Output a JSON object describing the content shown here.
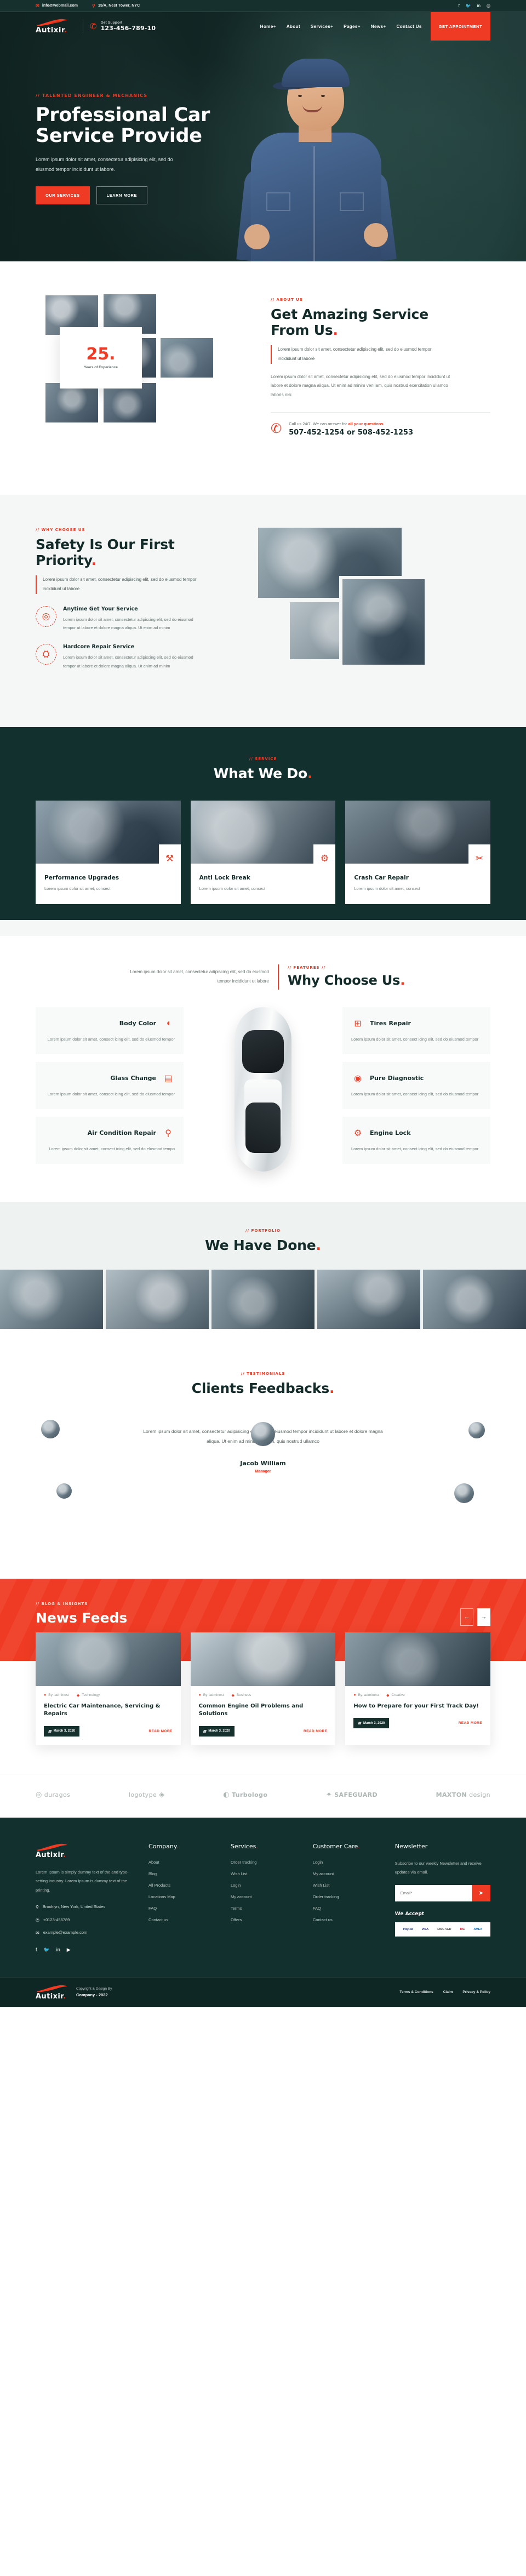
{
  "topbar": {
    "email": "info@webmail.com",
    "address": "15/A, Nest Tower, NYC",
    "socials": [
      "facebook-icon",
      "twitter-icon",
      "linkedin-icon",
      "instagram-icon"
    ]
  },
  "header": {
    "brand": "Autixir",
    "brand_dot": ".",
    "support_label": "Get Support",
    "support_phone": "123-456-789-10",
    "nav": [
      {
        "label": "Home",
        "caret": "+"
      },
      {
        "label": "About",
        "caret": ""
      },
      {
        "label": "Services",
        "caret": "+"
      },
      {
        "label": "Pages",
        "caret": "+"
      },
      {
        "label": "News",
        "caret": "+"
      },
      {
        "label": "Contact Us",
        "caret": ""
      }
    ],
    "cta": "GET APPOINTMENT"
  },
  "hero": {
    "eyebrow": "// TALENTED ENGINEER & MECHANICS",
    "title_line1": "Professional Car",
    "title_line2": "Service Provide",
    "subtitle": "Lorem ipsum dolor sit amet, consectetur adipisicing elit, sed do eiusmod tempor incididunt ut labore.",
    "btn_primary": "OUR SERVICES",
    "btn_secondary": "LEARN MORE"
  },
  "about": {
    "eyebrow": "// ABOUT US",
    "title_line1": "Get Amazing Service",
    "title_line2": "From Us",
    "lead": "Lorem ipsum dolor sit amet, consectetur adipiscing elit, sed do eiusmod tempor incididunt ut labore",
    "body": "Lorem ipsum dolor sit amet, consectetur adipisicing elit, sed do eiusmod tempor incididunt ut labore et dolore magna aliqua. Ut enim ad minim ven iam, quis nostrud exercitation ullamco laboris nisi",
    "experience_number": "25.",
    "experience_label": "Years of Experience",
    "call_prefix": "Call us 24/7. We can answer for ",
    "call_highlight": "all your questions",
    "call_suffix": ".",
    "phones": "507-452-1254 or 508-452-1253"
  },
  "safety": {
    "eyebrow": "// WHY CHOOSE US",
    "title_line1": "Safety Is Our First",
    "title_line2": "Priority",
    "lead": "Lorem ipsum dolor sit amet, consectetur adipiscing elit, sed do eiusmod tempor incididunt ut labore",
    "features": [
      {
        "icon": "wheel-icon",
        "glyph": "◎",
        "title": "Anytime Get Your Service",
        "text": "Lorem ipsum dolor sit amet, consectetur adipiscing elit, sed do eiusmod tempor ut labore et dolore magna aliqua. Ut enim ad minim"
      },
      {
        "icon": "car-wrench-icon",
        "glyph": "⛭",
        "title": "Hardcore Repair Service",
        "text": "Lorem ipsum dolor sit amet, consectetur adipiscing elit, sed do eiusmod tempor ut labore et dolore magna aliqua. Ut enim ad minim"
      }
    ]
  },
  "service": {
    "eyebrow": "// SERVICE",
    "title": "What We Do",
    "cards": [
      {
        "title": "Performance Upgrades",
        "text": "Lorem ipsum dolor sit amet, consect",
        "icon": "mechanic-tools-icon",
        "glyph": "⚒"
      },
      {
        "title": "Anti Lock Break",
        "text": "Lorem ipsum dolor sit amet, consect",
        "icon": "engine-gear-icon",
        "glyph": "⚙"
      },
      {
        "title": "Crash Car Repair",
        "text": "Lorem ipsum dolor sit amet, consect",
        "icon": "crossed-tools-icon",
        "glyph": "✂"
      }
    ]
  },
  "why": {
    "left_text": "Lorem ipsum dolor sit amet, consectetur adipiscing elit, sed do eiusmod tempor incididunt ut labore",
    "eyebrow": "// FEATURES //",
    "title": "Why Choose Us",
    "left_cards": [
      {
        "title": "Body Color",
        "text": "Lorem ipsum dolor sit amet, consect icing elit, sed do eiusmod tempor",
        "icon": "paint-spray-icon",
        "glyph": "◖"
      },
      {
        "title": "Glass Change",
        "text": "Lorem ipsum dolor sit amet, consect icing elit, sed do eiusmod tempor",
        "icon": "car-door-icon",
        "glyph": "▤"
      },
      {
        "title": "Air Condition Repair",
        "text": "Lorem ipsum dolor sit amet, consect icing elit, sed do elusmod tempo",
        "icon": "piston-icon",
        "glyph": "⚲"
      }
    ],
    "right_cards": [
      {
        "title": "Tires Repair",
        "text": "Lorem ipsum dolor sit amet, consect icing elit, sed do eiusmod tempor",
        "icon": "car-lift-icon",
        "glyph": "⊞"
      },
      {
        "title": "Pure Diagnostic",
        "text": "Lorem ipsum dolor sit amet, consect icing elit, sed do eiusmod tempor",
        "icon": "tire-icon",
        "glyph": "◉"
      },
      {
        "title": "Engine Lock",
        "text": "Lorem ipsum dolor sit amet, consect icing elit, sed do eiusmod tempor",
        "icon": "engine-icon",
        "glyph": "⚙"
      }
    ]
  },
  "portfolio": {
    "eyebrow": "// PORTFOLIO",
    "title": "We Have Done"
  },
  "testimonial": {
    "eyebrow": "// TESTIMONIALS",
    "title": "Clients Feedbacks",
    "quote": "Lorem ipsum dolor sit amet, consectetur adipisicing elit, sed do eiusmod tempor incididunt ut labore et dolore magna aliqua. Ut enim ad minim veniam, quis nostrud ullamco",
    "name": "Jacob William",
    "role": "Manager"
  },
  "news": {
    "eyebrow": "// BLOG & INSIGHTS",
    "title": "News Feeds",
    "prev": "←",
    "next": "→",
    "cards": [
      {
        "author": "By: adminest",
        "category": "Technology",
        "title": "Electric Car Maintenance, Servicing & Repairs",
        "date": "March 3, 2020",
        "more": "READ MORE"
      },
      {
        "author": "By: adminest",
        "category": "Business",
        "title": "Common Engine Oil Problems and Solutions",
        "date": "March 3, 2020",
        "more": "READ MORE"
      },
      {
        "author": "By: adminest",
        "category": "Creative",
        "title": "How to Prepare for your First Track Day!",
        "date": "March 3, 2020",
        "more": "READ MORE"
      }
    ]
  },
  "brands": [
    {
      "name": "duragos",
      "mark": "◎"
    },
    {
      "name": "logotype",
      "mark": "◈"
    },
    {
      "name": "Turbologo",
      "mark": "◐"
    },
    {
      "name": "SAFEGUARD",
      "mark": "✦"
    },
    {
      "name": "MAXTON",
      "mark": "",
      "sub": "design"
    }
  ],
  "footer": {
    "brand": "Autixir",
    "description": "Lorem Ipsum is simply dummy text of the and type-setting industry. Lorem Ipsum is dummy text of the printing.",
    "address": "Brooklyn, New York, United States",
    "phone": "+0123-456789",
    "email": "example@example.com",
    "socials": [
      "facebook-icon",
      "twitter-icon",
      "linkedin-icon",
      "youtube-icon"
    ],
    "columns": [
      {
        "heading": "Company",
        "dot": ".",
        "links": [
          "About",
          "Blog",
          "All Products",
          "Locations Map",
          "FAQ",
          "Contact us"
        ]
      },
      {
        "heading": "Services",
        "dot": ".",
        "links": [
          "Order tracking",
          "Wish List",
          "Login",
          "My account",
          "Terms",
          "Offers"
        ]
      },
      {
        "heading": "Customer Care",
        "dot": ".",
        "links": [
          "Login",
          "My account",
          "Wish List",
          "Order tracking",
          "FAQ",
          "Contact us"
        ]
      }
    ],
    "newsletter": {
      "heading": "Newsletter",
      "text": "Subscribe to our weekly Newsletter and receive updates via email.",
      "placeholder": "Email*",
      "submit_icon": "send-icon",
      "accept_label": "We Accept",
      "payments": [
        "PayPal",
        "VISA",
        "DISC VER",
        "MC",
        "AMEX"
      ]
    },
    "bottom": {
      "copy_small": "Copyright & Design By",
      "copy_strong": "Company - 2022",
      "links": [
        "Terms & Conditions",
        "Claim",
        "Privacy & Policy"
      ]
    }
  }
}
